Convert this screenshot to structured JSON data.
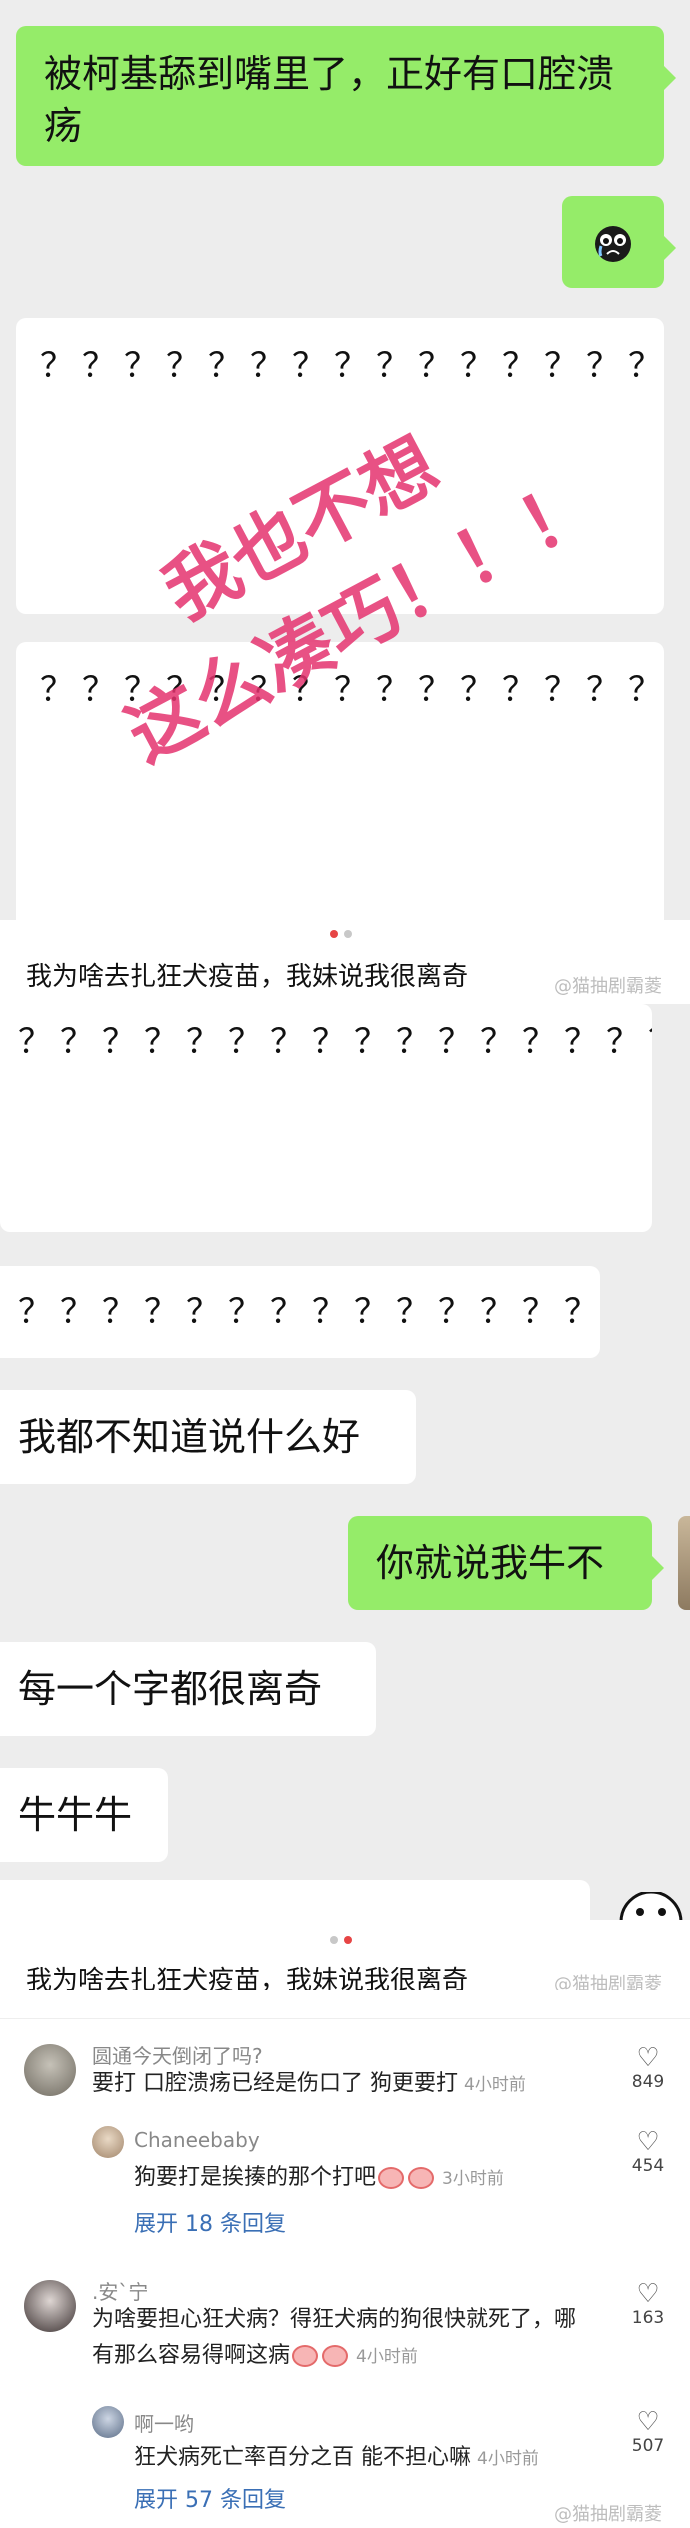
{
  "chat_top": {
    "msg1": "被柯基舔到嘴里了，正好有口腔溃疡",
    "q_block_1": "？？？？？？？？？？？？？？？？？？？？？？？？？？？？？？？？？？？？？？？？？？？？？？？？？？？？？？？？？？？？？？？？？？？？？？？",
    "q_block_2": "？？？？？？？？？？？？？？？？？？？？？？？？？？？？？？？？？？？？？？？？？？？？？？？？？？？？？？？？？？？？？？？？？？？？？？？？？？？？？？？？？？？？？？？？？？？？？？？？？？",
    "stamp_line1": "我也不想",
    "stamp_line2": "这么凑巧！！！"
  },
  "post_title_1": "我为啥去扎狂犬疫苗，我妹说我很离奇",
  "watermark": "@猫抽剧霸菱",
  "chat_mid": {
    "q_block_3": "？？？？？？？？？？？？？？？？？？？？？？？？？？？？？？？？？？？？？？？？？？？？？？？？？？？？？？？",
    "q_block_4": "？？？？？？？？？？？？？？",
    "msg_dont_know": "我都不知道说什么好",
    "msg_niubu": "你就说我牛不",
    "msg_every_word": "每一个字都很离奇",
    "msg_niuniuniu": "牛牛牛"
  },
  "post_title_2": "我为啥去扎狂犬疫苗，我妹说我很离奇",
  "comments": [
    {
      "user": "圆通今天倒闭了吗?",
      "text": "要打 口腔溃疡已经是伤口了 狗更要打",
      "time": "4小时前",
      "likes": "849",
      "reply": {
        "user": "Chaneebaby",
        "text": "狗要打是挨揍的那个打吧",
        "time": "3小时前",
        "likes": "454"
      },
      "expand": "展开 18 条回复"
    },
    {
      "user": ".安`宁",
      "text_line1": "为啥要担心狂犬病？得狂犬病的狗很快就死了，哪",
      "text_line2": "有那么容易得啊这病",
      "time": "4小时前",
      "likes": "163",
      "reply": {
        "user": "啊一哟",
        "text": "狂犬病死亡率百分之百  能不担心嘛",
        "time": "4小时前",
        "likes": "507"
      },
      "expand": "展开 57 条回复"
    }
  ],
  "colors": {
    "green_bubble": "#95ec69",
    "accent_stamp": "#e4326e",
    "link": "#3a6fb5"
  }
}
